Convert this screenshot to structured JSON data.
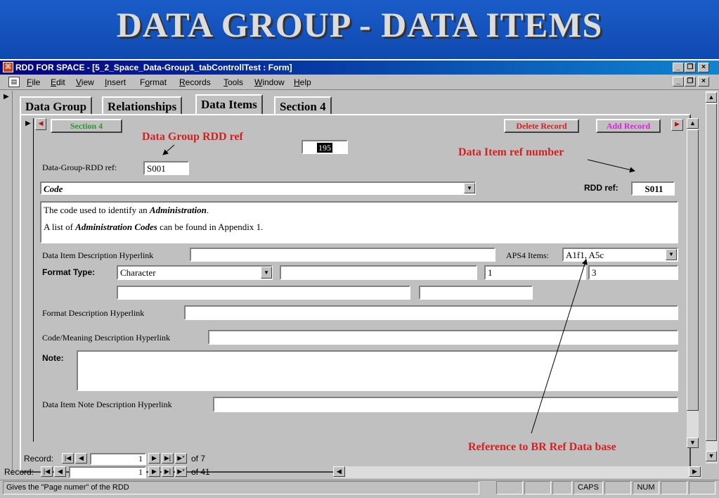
{
  "slide": {
    "title": "DATA GROUP - DATA ITEMS"
  },
  "window": {
    "title": "RDD FOR SPACE - [5_2_Space_Data-Group1_tabControllTest : Form]",
    "caption_buttons": [
      "_",
      "×"
    ],
    "caption_icons": [
      "minimize-icon",
      "restore-icon",
      "close-icon"
    ]
  },
  "menu": {
    "items": [
      {
        "first": "F",
        "rest": "ile"
      },
      {
        "first": "E",
        "rest": "dit"
      },
      {
        "first": "V",
        "rest": "iew"
      },
      {
        "first": "I",
        "rest": "nsert"
      },
      {
        "pre": "F",
        "first": "o",
        "rest": "rmat"
      },
      {
        "first": "R",
        "rest": "ecords"
      },
      {
        "first": "T",
        "rest": "ools"
      },
      {
        "first": "W",
        "rest": "indow"
      },
      {
        "first": "H",
        "rest": "elp"
      }
    ]
  },
  "tabs": [
    "Data Group",
    "Relationships",
    "Data Items",
    "Section 4"
  ],
  "active_tab": "Data Items",
  "form": {
    "section_button": "Section 4",
    "delete_button": "Delete Record",
    "add_button": "Add Record",
    "page_number": "195",
    "data_group_label": "Data-Group-RDD ref:",
    "data_group_value": "S001",
    "code_value": "Code",
    "rdd_ref_label": "RDD ref:",
    "rdd_ref_value": "S011",
    "description_line1_pre": "The code used to identify an ",
    "description_line1_em": "Administration",
    "description_line1_post": ".",
    "description_line2_pre": "A list of ",
    "description_line2_em": "Administration Codes",
    "description_line2_post": " can be found in Appendix 1.",
    "desc_hyperlink_label": "Data Item Description Hyperlink",
    "aps4_label": "APS4 Items:",
    "aps4_value": "A1f1, A5c",
    "format_type_label": "Format Type:",
    "format_type_value": "Character",
    "format_min": "1",
    "format_max": "3",
    "format_desc_label": "Format Description Hyperlink",
    "code_meaning_label": "Code/Meaning Description Hyperlink",
    "note_label": "Note:",
    "note_hyperlink_label": "Data Item Note Description Hyperlink"
  },
  "annotations": {
    "data_group_rdd_ref": "Data Group RDD  ref",
    "data_item_ref_number": "Data Item ref number",
    "reference_br": "Reference  to BR Ref Data base"
  },
  "inner_nav": {
    "label": "Record:",
    "current": "1",
    "of_text": "of 7"
  },
  "outer_nav": {
    "label": "Record:",
    "current": "1",
    "of_text": "of 41"
  },
  "status_bar": {
    "text": "Gives the \"Page numer\" of the RDD",
    "caps": "CAPS",
    "num": "NUM"
  },
  "colors": {
    "titlebar": "#000080",
    "slide_bg": "#1a5cc8",
    "annotation": "#d42020",
    "section_btn_text": "#2a9a2a",
    "delete_btn_text": "#d42020",
    "add_btn_text": "#e020e0"
  }
}
